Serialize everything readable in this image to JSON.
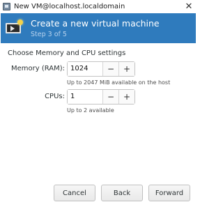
{
  "window": {
    "title": "New VM@localhost.localdomain",
    "close_glyph": "✕"
  },
  "header": {
    "title": "Create a new virtual machine",
    "step": "Step 3 of 5",
    "icon": "virtual-machine-icon"
  },
  "main": {
    "section_label": "Choose Memory and CPU settings",
    "memory": {
      "label": "Memory (RAM):",
      "value": "1024",
      "hint": "Up to 2047 MiB available on the host"
    },
    "cpus": {
      "label": "CPUs:",
      "value": "1",
      "hint": "Up to 2 available"
    },
    "minus_glyph": "−",
    "plus_glyph": "+"
  },
  "footer": {
    "cancel_label": "Cancel",
    "back_label": "Back",
    "forward_label": "Forward"
  },
  "colors": {
    "header_bg": "#2f7bbd",
    "step_text": "#b8d3ee"
  }
}
